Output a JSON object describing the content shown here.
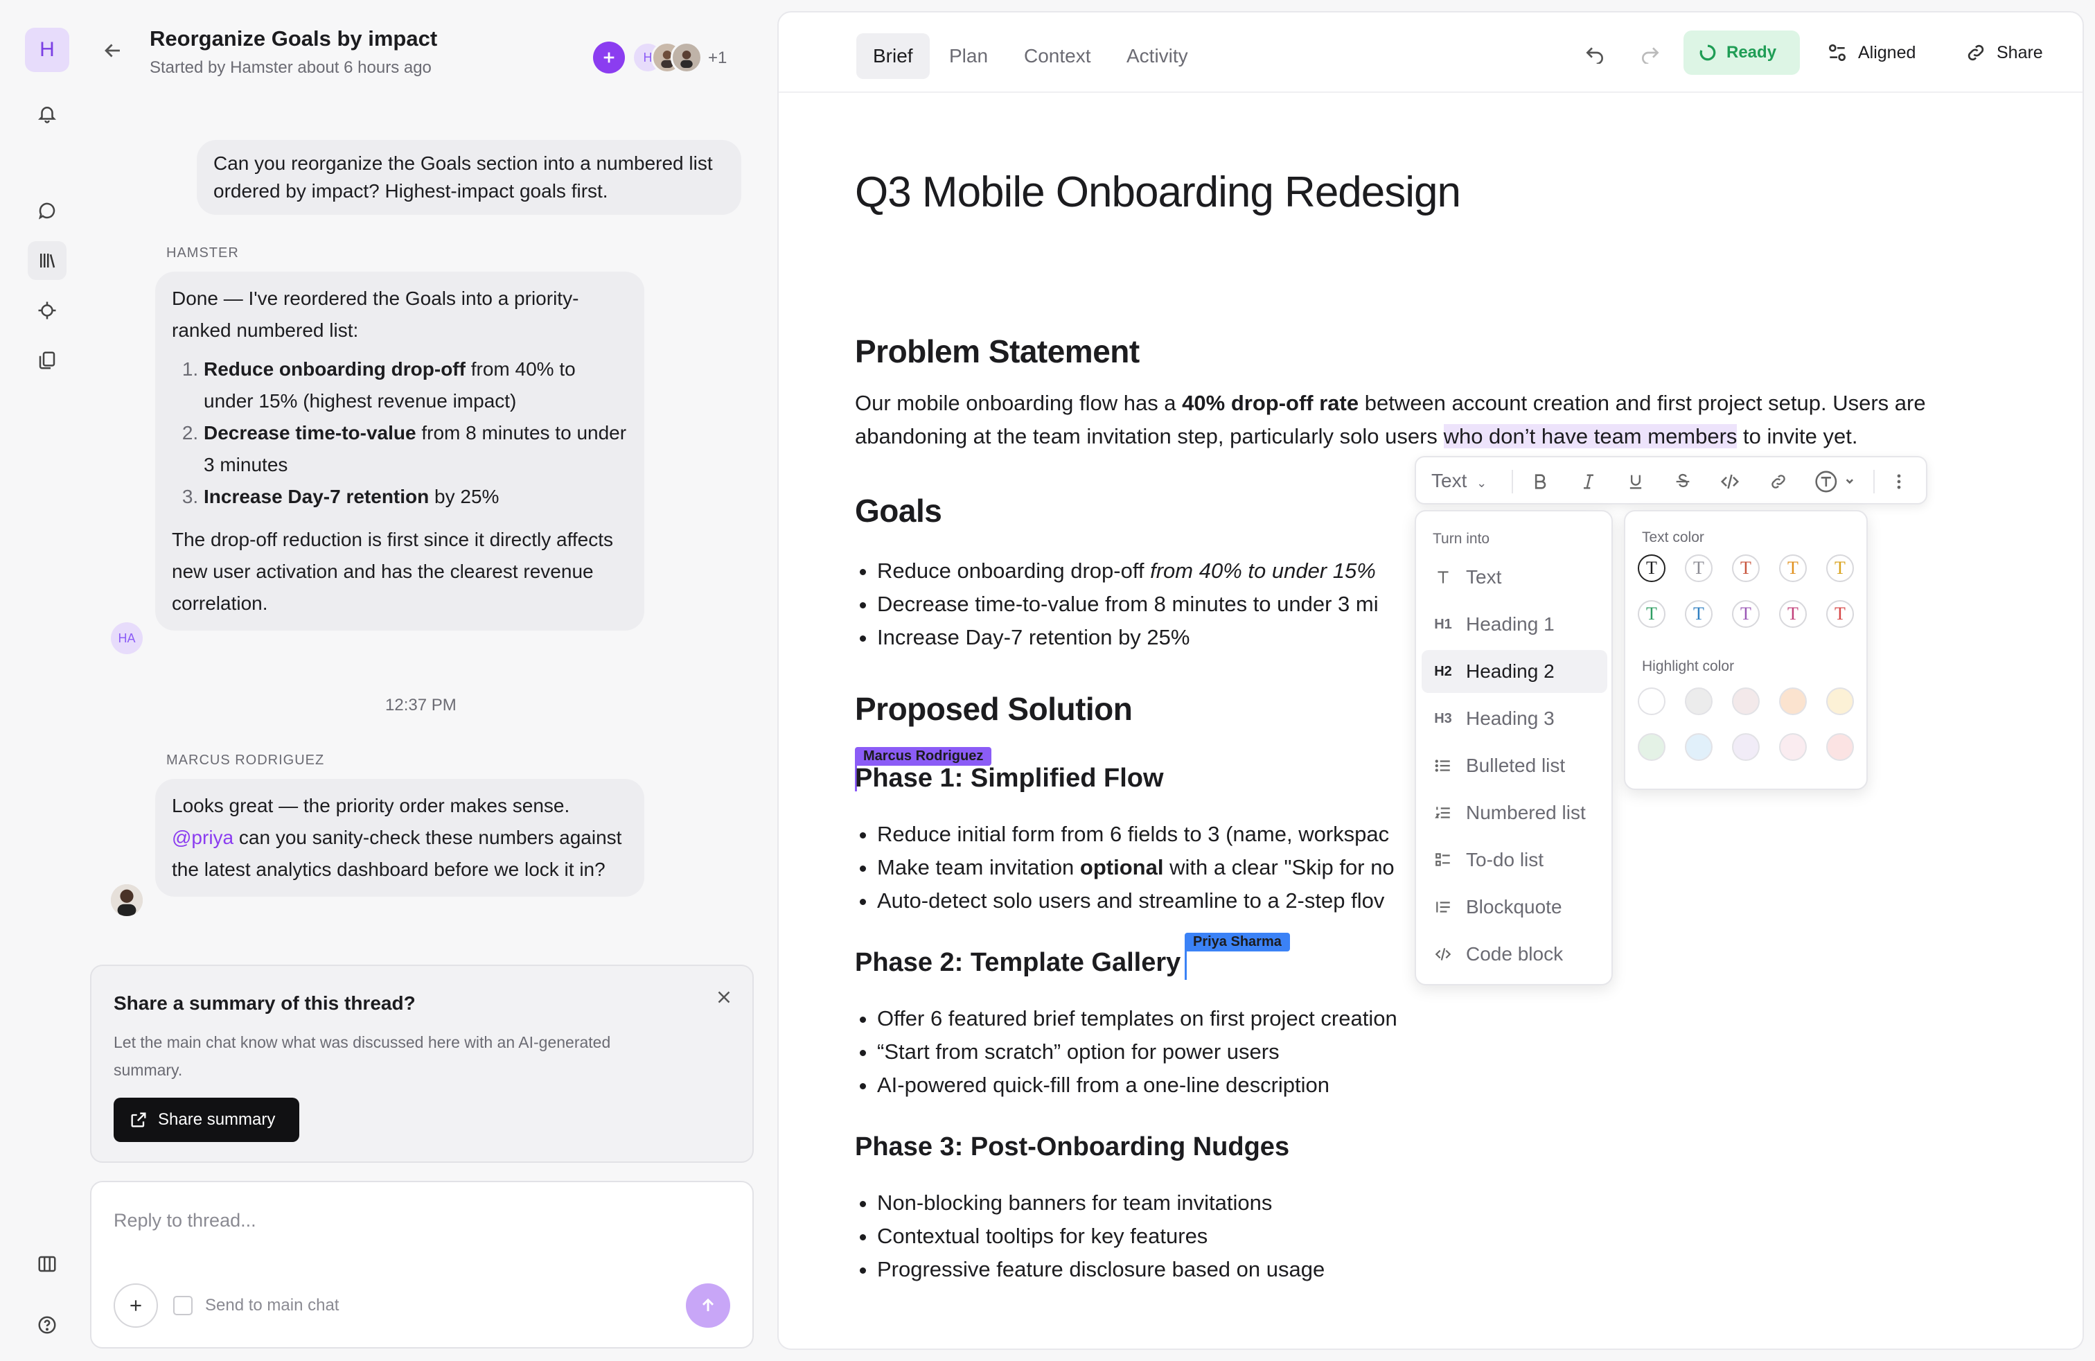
{
  "rail": {
    "logo": "H"
  },
  "thread": {
    "title": "Reorganize Goals by impact",
    "subtitle": "Started by Hamster about 6 hours ago",
    "participants": {
      "initials": "H",
      "extra": "+1"
    },
    "user_message": "Can you reorganize the Goals section into a numbered list ordered by impact? Highest-impact goals first.",
    "ai_sender": "HAMSTER",
    "ai_intro": "Done — I've reordered the Goals into a priority-ranked numbered list:",
    "ai_items": [
      {
        "bold": "Reduce onboarding drop-off",
        "rest": " from 40% to under 15% (highest revenue impact)"
      },
      {
        "bold": "Decrease time-to-value",
        "rest": " from 8 minutes to under 3 minutes"
      },
      {
        "bold": "Increase Day-7 retention",
        "rest": " by 25%"
      }
    ],
    "ai_outro": "The drop-off reduction is first since it directly affects new user activation and has the clearest revenue correlation.",
    "ai_avatar": "HA",
    "timestamp": "12:37 PM",
    "marcus_sender": "MARCUS RODRIGUEZ",
    "marcus_pre": "Looks great — the priority order makes sense.",
    "marcus_mention": "@priya",
    "marcus_post": " can you sanity-check these numbers against the latest analytics dashboard before we lock it in?",
    "summary": {
      "title": "Share a summary of this thread?",
      "desc": "Let the main chat know what was discussed here with an AI-generated summary.",
      "button": "Share summary"
    },
    "reply": {
      "placeholder": "Reply to thread...",
      "send_to_main": "Send to main chat"
    }
  },
  "doc": {
    "tabs": [
      "Brief",
      "Plan",
      "Context",
      "Activity"
    ],
    "active_tab": "Brief",
    "status": "Ready",
    "aligned_label": "Aligned",
    "share_label": "Share",
    "title": "Q3 Mobile Onboarding Redesign",
    "problem_heading": "Problem Statement",
    "problem_pre": "Our mobile onboarding flow has a ",
    "problem_bold": "40% drop-off rate",
    "problem_mid": " between account creation and first project setup. Users are abandoning at the team invitation step, particularly solo users ",
    "problem_highlight": "who don’t have team members",
    "problem_post": " to invite yet.",
    "goals_heading": "Goals",
    "goals": [
      {
        "text": "Reduce onboarding drop-off ",
        "italic": "from 40% to under 15%"
      },
      {
        "text": "Decrease time-to-value from 8 minutes to under 3 mi",
        "italic": ""
      },
      {
        "text": "Increase Day-7 retention by 25%",
        "italic": ""
      }
    ],
    "solution_heading": "Proposed Solution",
    "phase1_heading": "Phase 1: Simplified Flow",
    "phase1_items": [
      {
        "pre": "Reduce initial form from 6 fields to 3 (name, workspac",
        "bold": "",
        "post": ""
      },
      {
        "pre": "Make team invitation ",
        "bold": "optional",
        "post": " with a clear \"Skip for no"
      },
      {
        "pre": "Auto-detect solo users and streamline to a 2-step flov",
        "bold": "",
        "post": ""
      }
    ],
    "phase2_heading": "Phase 2: Template Gallery",
    "phase2_items": [
      "Offer 6 featured brief templates on first project creation",
      "“Start from scratch” option for power users",
      "AI-powered quick-fill from a one-line description"
    ],
    "phase3_heading": "Phase 3: Post-Onboarding Nudges",
    "phase3_items": [
      "Non-blocking banners for team invitations",
      "Contextual tooltips for key features",
      "Progressive feature disclosure based on usage"
    ],
    "cursors": {
      "marcus": {
        "name": "Marcus Rodriguez",
        "color": "#8b5cf6"
      },
      "priya": {
        "name": "Priya Sharma",
        "color": "#3b82f6"
      }
    }
  },
  "format_toolbar": {
    "block_type": "Text",
    "turn_into_heading": "Turn into",
    "turn_into": [
      {
        "icon": "text-icon",
        "glyph": "T",
        "label": "Text"
      },
      {
        "icon": "heading1-icon",
        "glyph": "H1",
        "label": "Heading 1"
      },
      {
        "icon": "heading2-icon",
        "glyph": "H2",
        "label": "Heading 2"
      },
      {
        "icon": "heading3-icon",
        "glyph": "H3",
        "label": "Heading 3"
      },
      {
        "icon": "bulleted-list-icon",
        "glyph": "",
        "label": "Bulleted list"
      },
      {
        "icon": "numbered-list-icon",
        "glyph": "",
        "label": "Numbered list"
      },
      {
        "icon": "todo-list-icon",
        "glyph": "",
        "label": "To-do list"
      },
      {
        "icon": "blockquote-icon",
        "glyph": "",
        "label": "Blockquote"
      },
      {
        "icon": "code-block-icon",
        "glyph": "",
        "label": "Code block"
      }
    ],
    "selected_turn_into": "Heading 2",
    "text_color_heading": "Text color",
    "text_colors": [
      "#1c1c1f",
      "#8a8a92",
      "#c8553d",
      "#e0901d",
      "#d9a21c",
      "#2f9e63",
      "#2f7fc1",
      "#9b59b6",
      "#c2407a",
      "#d64545"
    ],
    "highlight_heading": "Highlight color",
    "highlight_colors": [
      "#ffffff",
      "#ececec",
      "#f3e9ea",
      "#fbe3cf",
      "#fcf1d6",
      "#e4f2e6",
      "#e1f0fa",
      "#f1ecf7",
      "#faecf0",
      "#fbe3e3"
    ]
  }
}
